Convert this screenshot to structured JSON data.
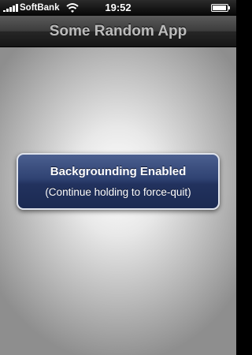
{
  "status_bar": {
    "carrier": "SoftBank",
    "time": "19:52",
    "signal_bars": 5,
    "battery_level": 1.0
  },
  "nav_bar": {
    "title": "Some Random App"
  },
  "alert": {
    "title": "Backgrounding Enabled",
    "message": "(Continue holding to force-quit)"
  },
  "colors": {
    "alert_background": "#2f4272",
    "alert_border": "#dfe3ec",
    "title_text": "#bcbcbc"
  }
}
